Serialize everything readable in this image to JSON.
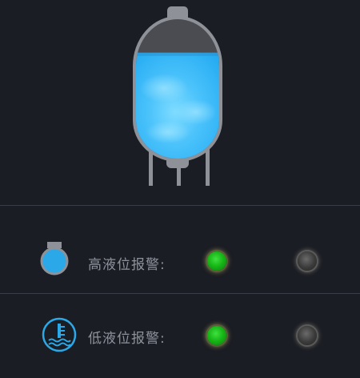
{
  "tank": {
    "fill_fraction": 0.76,
    "colors": {
      "body": "#8e9198",
      "empty_space": "#4a4c52",
      "liquid_light": "#7dd9ff",
      "liquid_dark": "#24a8f0"
    }
  },
  "alarms": [
    {
      "label": "高液位报警:",
      "icon": "tank-icon",
      "status_left": "on",
      "status_right": "off"
    },
    {
      "label": "低液位报警:",
      "icon": "temperature-level-icon",
      "status_left": "on",
      "status_right": "off"
    }
  ],
  "colors": {
    "background": "#1b1d24",
    "divider": "#3a3d45",
    "label": "#8e929b",
    "lamp_on": "#17b817",
    "lamp_off": "#3a3a3a",
    "icon_blue": "#2aa8e8"
  }
}
